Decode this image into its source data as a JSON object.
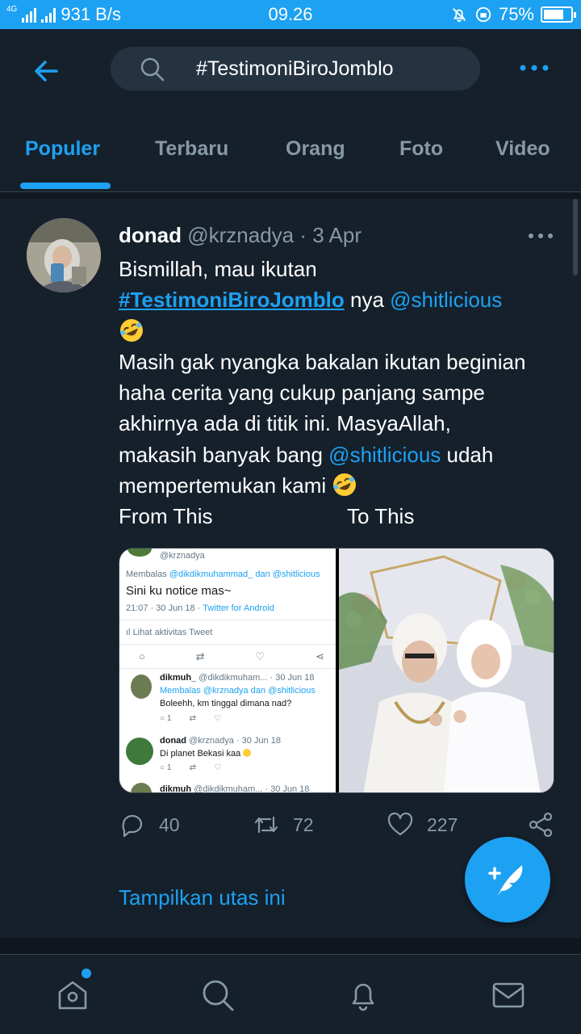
{
  "status_bar": {
    "network": "4G",
    "speed": "931 B/s",
    "time": "09.26",
    "battery": "75%",
    "battery_level": 0.75
  },
  "header": {
    "search_value": "#TestimoniBiroJomblo"
  },
  "tabs": [
    {
      "label": "Populer",
      "active": true
    },
    {
      "label": "Terbaru",
      "active": false
    },
    {
      "label": "Orang",
      "active": false
    },
    {
      "label": "Foto",
      "active": false
    },
    {
      "label": "Video",
      "active": false
    }
  ],
  "tweet": {
    "name": "donad",
    "handle": "@krznadya",
    "separator": "·",
    "date": "3 Apr",
    "text": {
      "l1": "Bismillah, mau ikutan",
      "hashtag": "#TestimoniBiroJomblo",
      "l2_mid": " nya ",
      "mention": "@shitlicious",
      "l4": "Masih gak nyangka bakalan ikutan beginian",
      "l5": "haha cerita yang cukup panjang sampe",
      "l6": "akhirnya ada di titik ini. MasyaAllah,",
      "l7_pre": "makasih banyak bang ",
      "l7_post": " udah",
      "l8": "mempertemukan kami ",
      "from": "From This",
      "to": "To This"
    },
    "replies": "40",
    "retweets": "72",
    "likes": "227",
    "show_thread": "Tampilkan utas ini"
  },
  "screenshot_media": {
    "top_handle": "@krznadya",
    "reply_to_prefix": "Membalas ",
    "reply_to_users": "@dikdikmuhammad_ dan @shitlicious",
    "main_text": "Sini ku notice mas~",
    "timestamp": "21:07 · 30 Jun 18 · ",
    "client": "Twitter for Android",
    "activity": "Lihat aktivitas Tweet",
    "reply1_name": "dikmuh_",
    "reply1_meta": "@dikdikmuham... · 30 Jun 18",
    "reply1_to": "Membalas @krznadya dan @shitlicious",
    "reply1_text": "Boleehh, km tinggal dimana nad?",
    "reply1_count": "1",
    "reply2_name": "donad",
    "reply2_meta": "@krznadya · 30 Jun 18",
    "reply2_text": "Di planet Bekasi kaa",
    "reply2_count": "1",
    "reply3_name": "dikmuh",
    "reply3_meta": "@dikdikmuham... · 30 Jun 18"
  },
  "colors": {
    "accent": "#1da1f2",
    "background": "#15202b",
    "secondary_text": "#8899a6"
  },
  "icons": {
    "back": "arrow-left-icon",
    "search": "search-icon",
    "more": "more-horizontal-icon",
    "reply": "reply-icon",
    "retweet": "retweet-icon",
    "like": "heart-icon",
    "share": "share-icon",
    "compose": "compose-icon",
    "home": "home-icon",
    "explore": "search-icon",
    "notifications": "bell-icon",
    "messages": "mail-icon"
  }
}
